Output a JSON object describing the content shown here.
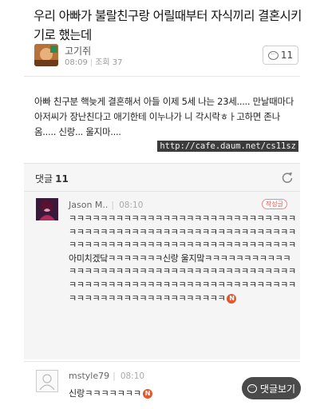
{
  "post": {
    "title": "우리 아빠가 불랄친구랑 어릴때부터 자식끼리 결혼시키기로 했는데",
    "author": "고기쥐",
    "time": "08:09",
    "views_label": "조회 37",
    "comment_count": "11",
    "body": "아빠 친구분 핵늦게 결혼해서 아들 이제 5세 나는 23세..... 만날때마다 아저씨가 장난친다고 애기한테 이누나가 니 각시락ㅎㅏ고하면 존나 옴..... 신랑... 울지마....",
    "source_link": "http://cafe.daum.net/cs11sz"
  },
  "comments_header": {
    "label": "댓글",
    "count": "11"
  },
  "comments": [
    {
      "author": "Jason M..",
      "time": "08:10",
      "badge": "작성글",
      "text": "ㅋㅋㅋㅋㅋㅋㅋㅋㅋㅋㅋㅋㅋㅋㅋㅋㅋㅋㅋㅋㅋㅋㅋㅋㅋㅋㅋㅋㅋㅋㅋㅋㅋㅋㅋㅋㅋㅋㅋㅋㅋㅋㅋㅋㅋㅋㅋㅋㅋㅋㅋㅋㅋㅋㅋㅋㅋㅋㅋㅋㅋㅋㅋㅋㅋㅋㅋㅋㅋㅋㅋㅋㅋㅋㅋㅋㅋㅋㅋㅋㅋㅋㅋㅋㅋㅋㅋ 아미치겠닼ㅋㅋㅋㅋㅋㅋㅋ신랑 울지맠ㅋㅋㅋㅋㅋㅋㅋㅋㅋㅋㅋㅋㅋㅋㅋㅋㅋㅋㅋㅋㅋㅋㅋㅋㅋㅋㅋㅋㅋㅋㅋㅋㅋㅋㅋㅋㅋㅋㅋㅋㅋㅋㅋㅋㅋㅋㅋㅋㅋㅋㅋㅋㅋㅋㅋㅋㅋㅋㅋㅋㅋㅋㅋㅋㅋㅋㅋㅋㅋㅋㅋㅋㅋㅋㅋㅋㅋㅋㅋㅋㅋㅋㅋㅋㅋㅋㅋㅋㅋ",
      "new_badge": "N"
    },
    {
      "author": "mstyle79",
      "time": "08:10",
      "text": "신랑ㅋㅋㅋㅋㅋㅋㅋ",
      "new_badge": "N"
    }
  ],
  "write_comment_label": "댓글보기",
  "colors": {
    "new_badge": "#e4572e",
    "author_badge": "#e55555",
    "comment_bg": "#f5f5f5"
  }
}
